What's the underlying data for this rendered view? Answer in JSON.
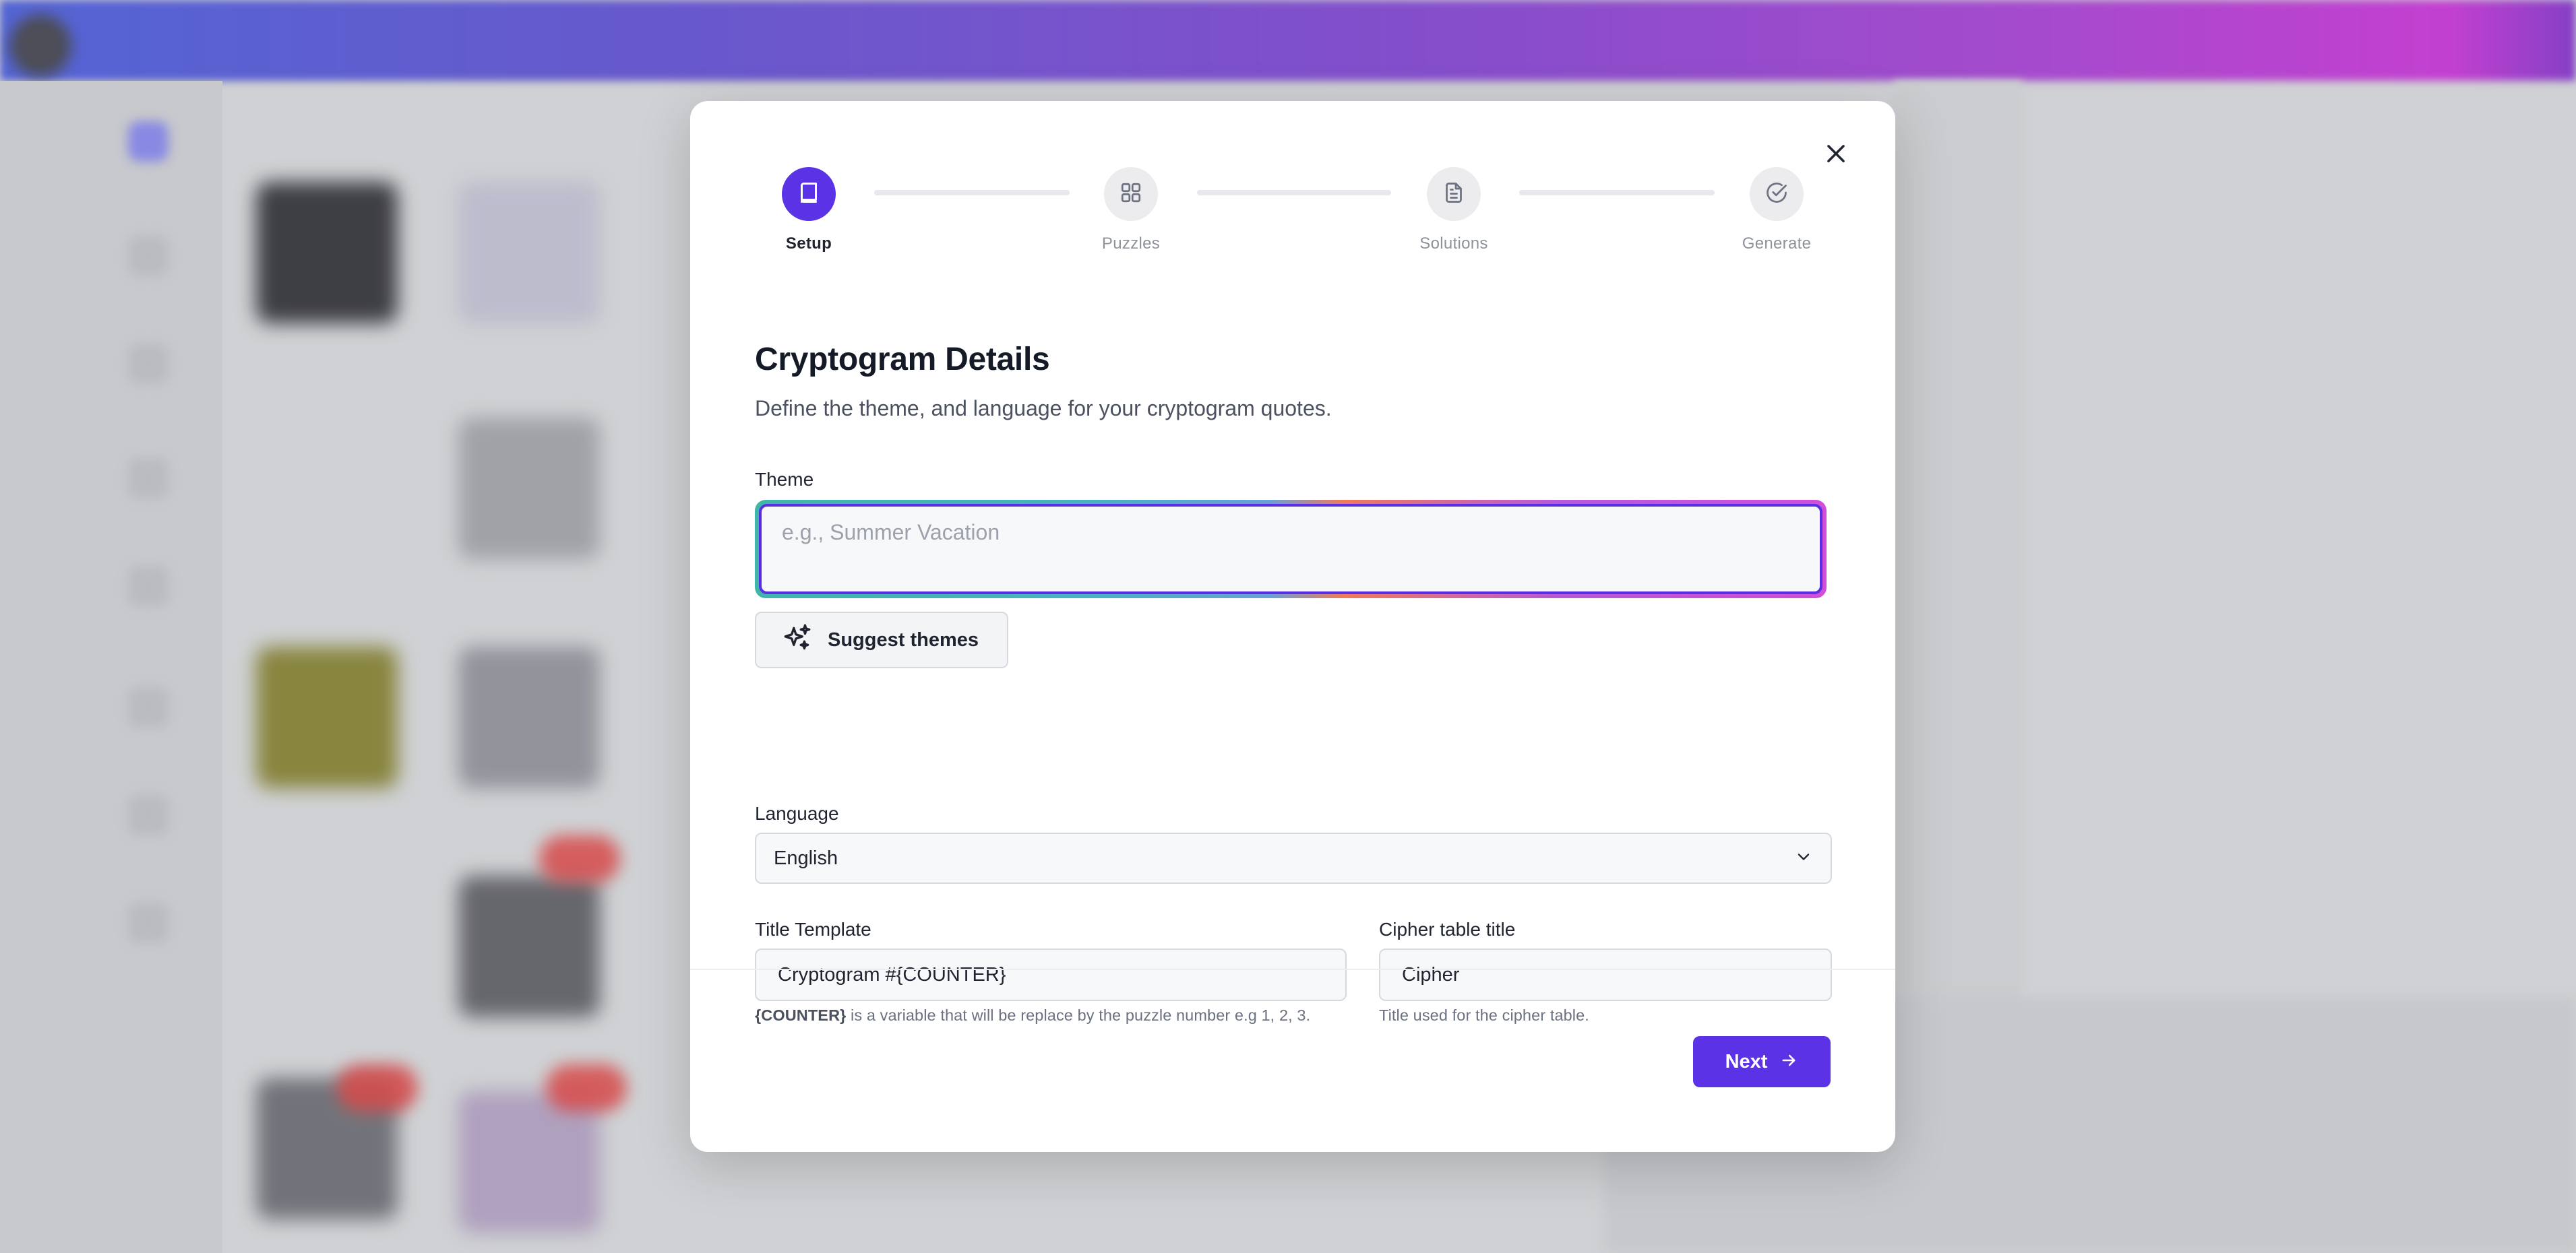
{
  "modal": {
    "steps": [
      {
        "label": "Setup",
        "icon": "book-icon",
        "active": true
      },
      {
        "label": "Puzzles",
        "icon": "grid-icon",
        "active": false
      },
      {
        "label": "Solutions",
        "icon": "document-icon",
        "active": false
      },
      {
        "label": "Generate",
        "icon": "check-circle-icon",
        "active": false
      }
    ],
    "heading": "Cryptogram Details",
    "subheading": "Define the theme, and language for your cryptogram quotes.",
    "theme": {
      "label": "Theme",
      "value": "",
      "placeholder": "e.g., Summer Vacation"
    },
    "suggest_button": "Suggest themes",
    "language": {
      "label": "Language",
      "selected": "English"
    },
    "title_template": {
      "label": "Title Template",
      "value": "Cryptogram #{COUNTER}",
      "helper_var": "{COUNTER}",
      "helper_text": " is a variable that will be replace by the puzzle number e.g 1, 2, 3."
    },
    "cipher_title": {
      "label": "Cipher table title",
      "value": "Cipher",
      "helper": "Title used for the cipher table."
    },
    "next_button": "Next"
  },
  "colors": {
    "accent": "#5b32e6",
    "heading": "#141a26",
    "muted": "#6b7180"
  }
}
